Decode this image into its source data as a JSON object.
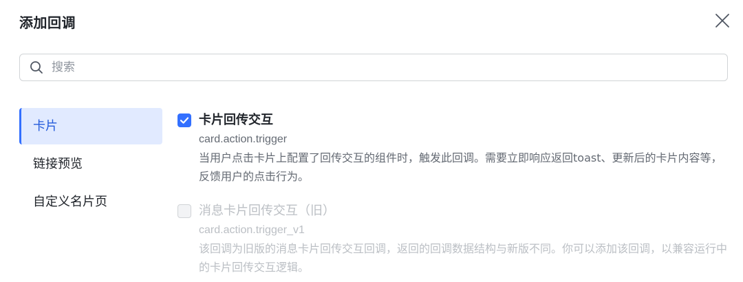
{
  "dialog": {
    "title": "添加回调",
    "close_icon": "close-icon"
  },
  "search": {
    "placeholder": "搜索",
    "value": "",
    "icon": "search-icon"
  },
  "sidebar": {
    "items": [
      {
        "label": "卡片",
        "active": true
      },
      {
        "label": "链接预览",
        "active": false
      },
      {
        "label": "自定义名片页",
        "active": false
      }
    ]
  },
  "options": [
    {
      "checked": true,
      "disabled": false,
      "title": "卡片回传交互",
      "code": "card.action.trigger",
      "description": "当用户点击卡片上配置了回传交互的组件时，触发此回调。需要立即响应返回toast、更新后的卡片内容等，反馈用户的点击行为。"
    },
    {
      "checked": false,
      "disabled": true,
      "title": "消息卡片回传交互（旧）",
      "code": "card.action.trigger_v1",
      "description": "该回调为旧版的消息卡片回传交互回调，返回的回调数据结构与新版不同。你可以添加该回调，以兼容运行中的卡片回传交互逻辑。"
    }
  ],
  "colors": {
    "accent": "#3370ff",
    "active_bg": "#e1eaff",
    "text_primary": "#1f2329",
    "text_secondary": "#646a73",
    "text_disabled": "#bbbfc4"
  }
}
